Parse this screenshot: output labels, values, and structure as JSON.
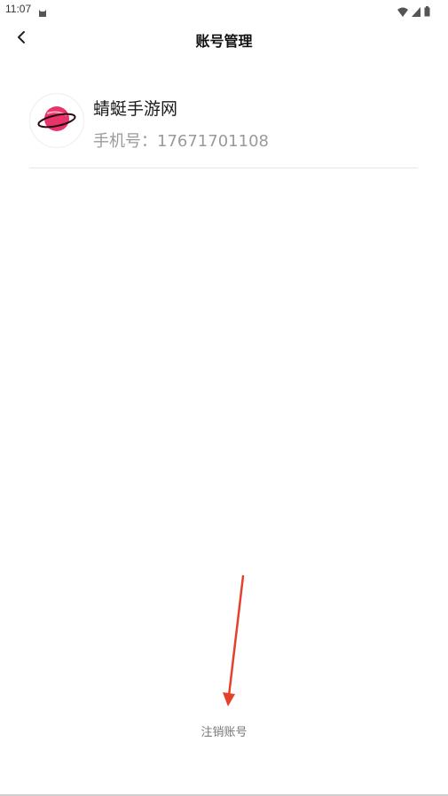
{
  "status_bar": {
    "time": "11:07",
    "icons": [
      "cat-icon",
      "wifi-icon",
      "signal-icon",
      "battery-icon"
    ]
  },
  "header": {
    "title": "账号管理",
    "back_icon": "chevron-left-icon"
  },
  "account": {
    "name": "蜻蜓手游网",
    "phone": "手机号：17671701108",
    "avatar_icon": "planet-icon"
  },
  "footer": {
    "cancel_label": "注销账号"
  },
  "colors": {
    "annotation_arrow": "#e5402a",
    "planet": "#e8336b",
    "divider": "#e6e6e6"
  }
}
